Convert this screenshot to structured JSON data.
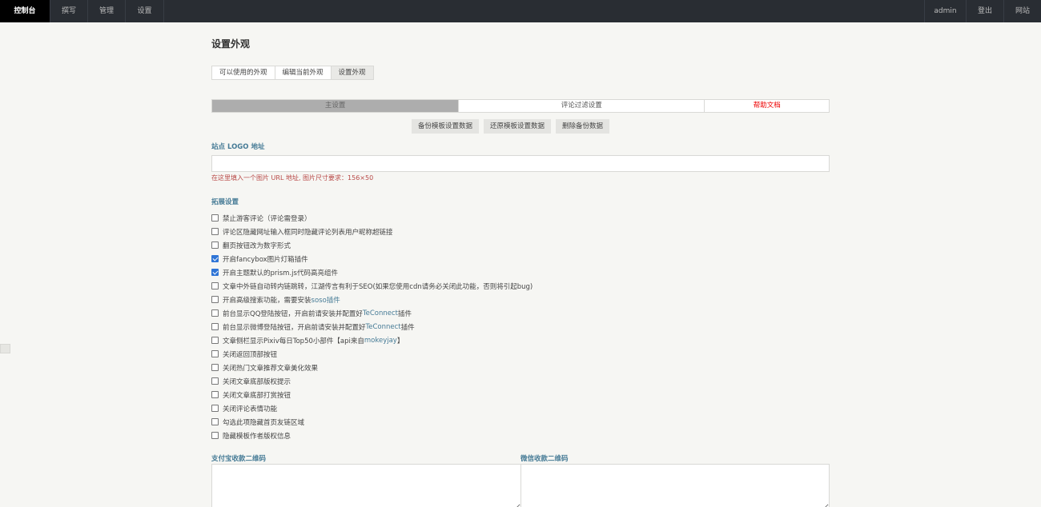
{
  "nav": {
    "left": [
      {
        "label": "控制台",
        "active": true
      },
      {
        "label": "撰写",
        "active": false
      },
      {
        "label": "管理",
        "active": false
      },
      {
        "label": "设置",
        "active": false
      }
    ],
    "right": [
      {
        "label": "admin"
      },
      {
        "label": "登出"
      },
      {
        "label": "网站"
      }
    ]
  },
  "page": {
    "title": "设置外观",
    "subtabs": [
      {
        "label": "可以使用的外观",
        "active": false
      },
      {
        "label": "编辑当前外观",
        "active": false
      },
      {
        "label": "设置外观",
        "active": true
      }
    ],
    "tabs": [
      {
        "label": "主设置",
        "active": true
      },
      {
        "label": "评论过滤设置",
        "active": false
      },
      {
        "label": "帮助文档",
        "active": false
      }
    ],
    "backup_buttons": [
      "备份模板设置数据",
      "还原模板设置数据",
      "删除备份数据"
    ]
  },
  "logo": {
    "label": "站点 LOGO 地址",
    "value": "",
    "hint": "在这里填入一个图片 URL 地址, 图片尺寸要求：156×50"
  },
  "extend": {
    "label": "拓展设置",
    "options": [
      {
        "text": "禁止游客评论（评论需登录）",
        "checked": false
      },
      {
        "text": "评论区隐藏网址输入框同时隐藏评论列表用户昵称超链接",
        "checked": false
      },
      {
        "text": "翻页按钮改为数字形式",
        "checked": false
      },
      {
        "text": "开启fancybox图片灯箱插件",
        "checked": true
      },
      {
        "text": "开启主题默认的prism.js代码高亮组件",
        "checked": true
      },
      {
        "text": "文章中外链自动转内链跳转，江湖传言有利于SEO(如果您使用cdn请务必关闭此功能，否则将引起bug)",
        "checked": false
      },
      {
        "pre": "开启高级搜索功能，需要安装",
        "link": "soso插件",
        "post": "",
        "checked": false
      },
      {
        "pre": "前台显示QQ登陆按钮，开启前请安装并配置好",
        "link": "TeConnect",
        "post": "插件",
        "checked": false
      },
      {
        "pre": "前台显示微博登陆按钮，开启前请安装并配置好",
        "link": "TeConnect",
        "post": "插件",
        "checked": false
      },
      {
        "pre": "文章侧栏显示Pixiv每日Top50小部件【api来自",
        "link": "mokeyjay",
        "post": "】",
        "checked": false
      },
      {
        "text": "关闭返回顶部按钮",
        "checked": false
      },
      {
        "text": "关闭热门文章推荐文章美化效果",
        "checked": false
      },
      {
        "text": "关闭文章底部版权提示",
        "checked": false
      },
      {
        "text": "关闭文章底部打赏按钮",
        "checked": false
      },
      {
        "text": "关闭评论表情功能",
        "checked": false
      },
      {
        "text": "勾选此项隐藏首页友链区域",
        "checked": false
      },
      {
        "text": "隐藏模板作者版权信息",
        "checked": false
      }
    ]
  },
  "qr": {
    "alipay_label": "支付宝收款二维码",
    "wechat_label": "微信收款二维码"
  },
  "colors": {
    "topbar": "#292d33",
    "accent_label": "#467b96",
    "hint_red": "#b94a48",
    "checkbox_checked": "#2f75d6"
  }
}
